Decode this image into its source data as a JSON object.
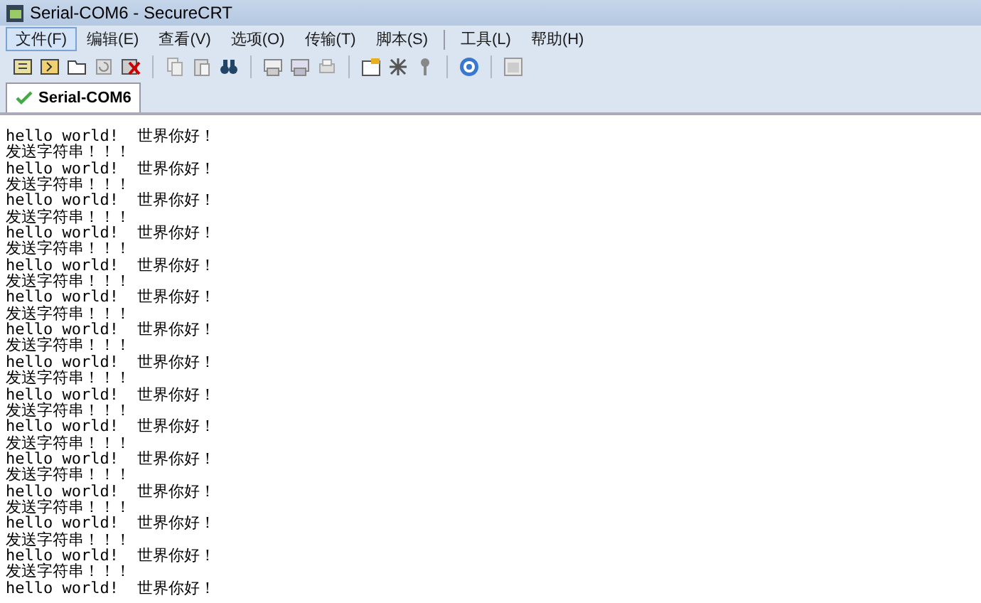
{
  "window": {
    "title": "Serial-COM6 - SecureCRT"
  },
  "menu": [
    {
      "label": "文件(F)",
      "selected": true
    },
    {
      "label": "编辑(E)",
      "selected": false
    },
    {
      "label": "查看(V)",
      "selected": false
    },
    {
      "label": "选项(O)",
      "selected": false
    },
    {
      "label": "传输(T)",
      "selected": false
    },
    {
      "label": "脚本(S)",
      "selected": false
    },
    {
      "label": "工具(L)",
      "selected": false
    },
    {
      "label": "帮助(H)",
      "selected": false
    }
  ],
  "tabs": [
    {
      "label": "Serial-COM6",
      "selected": true
    }
  ],
  "terminal_lines": [
    "hello world!  世界你好！",
    "发送字符串！！！",
    "hello world!  世界你好！",
    "发送字符串！！！",
    "hello world!  世界你好！",
    "发送字符串！！！",
    "hello world!  世界你好！",
    "发送字符串！！！",
    "hello world!  世界你好！",
    "发送字符串！！！",
    "hello world!  世界你好！",
    "发送字符串！！！",
    "hello world!  世界你好！",
    "发送字符串！！！",
    "hello world!  世界你好！",
    "发送字符串！！！",
    "hello world!  世界你好！",
    "发送字符串！！！",
    "hello world!  世界你好！",
    "发送字符串！！！",
    "hello world!  世界你好！",
    "发送字符串！！！",
    "hello world!  世界你好！",
    "发送字符串！！！",
    "hello world!  世界你好！",
    "发送字符串！！！",
    "hello world!  世界你好！",
    "发送字符串！！！",
    "hello world!  世界你好！"
  ]
}
